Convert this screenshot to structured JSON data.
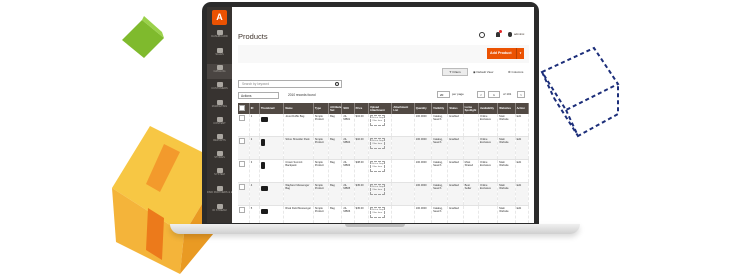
{
  "app": {
    "logo_letter": "A"
  },
  "sidebar": {
    "items": [
      {
        "label": "DASHBOARD"
      },
      {
        "label": "SALES"
      },
      {
        "label": "CATALOG"
      },
      {
        "label": "CUSTOMERS"
      },
      {
        "label": "MARKETING"
      },
      {
        "label": "CONTENT"
      },
      {
        "label": "REPORTS"
      },
      {
        "label": "STORES"
      },
      {
        "label": "SYSTEM"
      },
      {
        "label": "FIND PARTNERS & EXTENSIONS"
      },
      {
        "label": "ID STREAM"
      }
    ]
  },
  "header": {
    "title": "Products",
    "user_name": "adminsi"
  },
  "actions": {
    "add_product": "Add Product"
  },
  "toolbar": {
    "filters": "Filters",
    "default_view": "Default View",
    "columns": "Columns"
  },
  "search": {
    "placeholder": "Search by keyword"
  },
  "grid_controls": {
    "actions_label": "Actions",
    "records_found": "2010 records found",
    "per_page_value": "20",
    "per_page_label": "per page",
    "prev": "<",
    "page": "1",
    "page_of": "of 101",
    "next": ">"
  },
  "table": {
    "columns": [
      "",
      "ID",
      "Thumbnail",
      "Name",
      "Type",
      "Attribute Set",
      "SKU",
      "Price",
      "Upload Attachment",
      "Attachment List",
      "Quantity",
      "Visibility",
      "Status",
      "Luma Spotlight",
      "Availability",
      "Websites",
      "Action"
    ],
    "attachment_text": "Click or Drop Files here",
    "rows": [
      {
        "id": "1",
        "name": "Joust Duffle Bag",
        "type": "Simple Product",
        "attr": "Bag",
        "sku": "24-MB01",
        "price": "$34.00",
        "qty": "100.0000",
        "visibility": "Catalog, Search",
        "status": "Enabled",
        "spotlight": "",
        "availability": "Online Exclusive",
        "websites": "Main Website",
        "action": "Edit"
      },
      {
        "id": "2",
        "name": "Strive Shoulder Pack",
        "type": "Simple Product",
        "attr": "Bag",
        "sku": "24-MB04",
        "price": "$32.00",
        "qty": "100.0000",
        "visibility": "Catalog, Search",
        "status": "Enabled",
        "spotlight": "",
        "availability": "Online Exclusive",
        "websites": "Main Website",
        "action": "Edit"
      },
      {
        "id": "3",
        "name": "Crown Summit Backpack",
        "type": "Simple Product",
        "attr": "Bag",
        "sku": "24-MB03",
        "price": "$38.00",
        "qty": "100.0000",
        "visibility": "Catalog, Search",
        "status": "Enabled",
        "spotlight": "Most Shared",
        "availability": "Online Exclusive",
        "websites": "Main Website",
        "action": "Edit"
      },
      {
        "id": "4",
        "name": "Wayfarer Messenger Bag",
        "type": "Simple Product",
        "attr": "Bag",
        "sku": "24-MB05",
        "price": "$45.00",
        "qty": "100.0000",
        "visibility": "Catalog, Search",
        "status": "Enabled",
        "spotlight": "Best Seller",
        "availability": "Online Exclusive",
        "websites": "Main Website",
        "action": "Edit"
      },
      {
        "id": "5",
        "name": "Rival Field Messenger",
        "type": "Simple Product",
        "attr": "Bag",
        "sku": "24-MB06",
        "price": "$45.00",
        "qty": "100.0000",
        "visibility": "Catalog, Search",
        "status": "Enabled",
        "spotlight": "",
        "availability": "",
        "websites": "Main Website",
        "action": "Edit"
      }
    ]
  },
  "colors": {
    "accent": "#eb5202",
    "sidebar": "#373330",
    "table_header": "#514943",
    "link": "#007bdb"
  }
}
